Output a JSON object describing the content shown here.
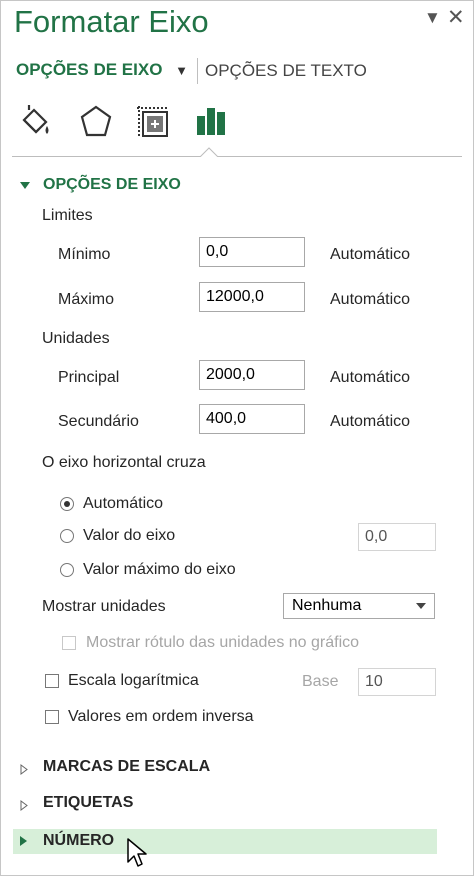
{
  "pane": {
    "title": "Formatar Eixo",
    "tab_axis_options": "OPÇÕES DE EIXO",
    "tab_text_options": "OPÇÕES DE TEXTO",
    "category_icons": [
      "fill-line-icon",
      "effects-icon",
      "size-properties-icon",
      "axis-options-icon"
    ]
  },
  "axis_options": {
    "heading": "OPÇÕES DE EIXO",
    "bounds_label": "Limites",
    "minimum_label": "Mínimo",
    "minimum_value": "0,0",
    "minimum_auto": "Automático",
    "maximum_label": "Máximo",
    "maximum_value": "12000,0",
    "maximum_auto": "Automático",
    "units_label": "Unidades",
    "major_label": "Principal",
    "major_value": "2000,0",
    "major_auto": "Automático",
    "minor_label": "Secundário",
    "minor_value": "400,0",
    "minor_auto": "Automático",
    "crosses_label": "O eixo horizontal cruza",
    "cross_automatic": "Automático",
    "cross_axis_value": "Valor do eixo",
    "cross_axis_value_input": "0,0",
    "cross_max_value": "Valor máximo do eixo",
    "display_units_label": "Mostrar unidades",
    "display_units_value": "Nenhuma",
    "show_units_label": "Mostrar rótulo das unidades no gráfico",
    "log_scale_label": "Escala logarítmica",
    "base_label": "Base",
    "base_value": "10",
    "reverse_order_label": "Valores em ordem inversa"
  },
  "sections": {
    "tick_marks": "MARCAS DE ESCALA",
    "labels": "ETIQUETAS",
    "number": "NÚMERO"
  },
  "colors": {
    "accent": "#217346",
    "highlight": "#d7efd9"
  }
}
